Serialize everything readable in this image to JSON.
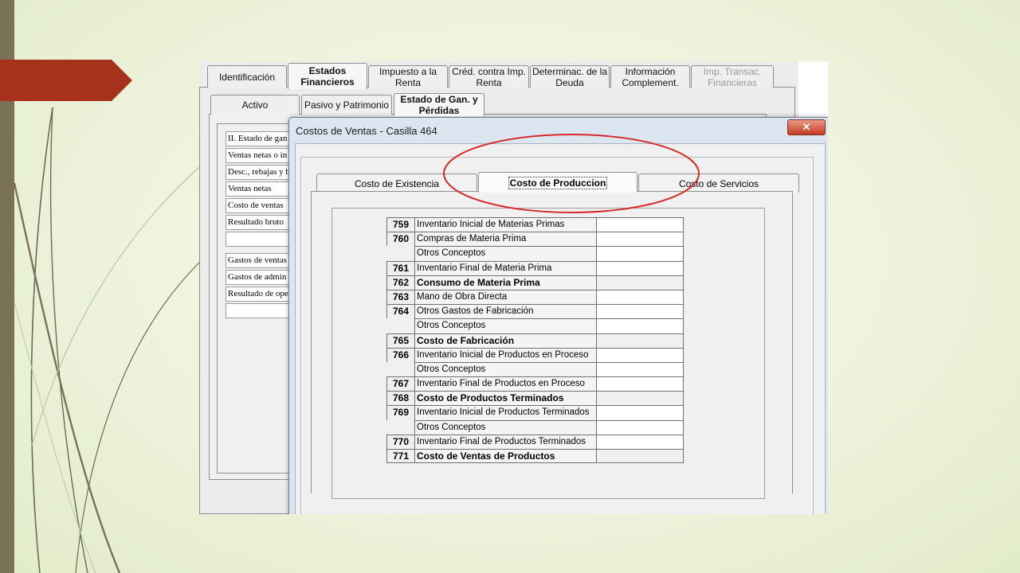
{
  "main_tabs": [
    {
      "label": [
        "Identificación"
      ],
      "state": "normal"
    },
    {
      "label": [
        "Estados",
        "Financieros"
      ],
      "state": "active"
    },
    {
      "label": [
        "Impuesto a la",
        "Renta"
      ],
      "state": "normal"
    },
    {
      "label": [
        "Créd. contra Imp.",
        "Renta"
      ],
      "state": "normal"
    },
    {
      "label": [
        "Determinac. de la",
        "Deuda"
      ],
      "state": "normal"
    },
    {
      "label": [
        "Información",
        "Complement."
      ],
      "state": "normal"
    },
    {
      "label": [
        "Imp. Transac.",
        "Financieras"
      ],
      "state": "disabled"
    }
  ],
  "sub_tabs": [
    {
      "label": [
        "Activo"
      ],
      "state": "normal"
    },
    {
      "label": [
        "Pasivo y Patrimonio"
      ],
      "state": "normal"
    },
    {
      "label": [
        "Estado de Gan. y",
        "Pérdidas"
      ],
      "state": "active"
    }
  ],
  "background_rows": [
    "II. Estado de gan",
    "Ventas netas o in",
    "Desc., rebajas y b",
    "Ventas netas",
    "Costo de ventas",
    "Resultado bruto",
    "",
    "Gastos de ventas",
    "Gastos de admin",
    "Resultado de ope",
    ""
  ],
  "dialog": {
    "title": "Costos de Ventas - Casilla 464",
    "close_label": "✕",
    "tabs": [
      {
        "label": "Costo de Existencia",
        "state": "normal"
      },
      {
        "label": "Costo de Produccion",
        "state": "active"
      },
      {
        "label": "Costo de Servicios",
        "state": "normal"
      }
    ],
    "rows": [
      {
        "code": "759",
        "label": "Inventario Inicial de Materias Primas",
        "bold": false,
        "editable": true,
        "value": ""
      },
      {
        "code": "760",
        "label": "Compras de Materia Prima",
        "bold": false,
        "editable": true,
        "value": ""
      },
      {
        "code": "",
        "label": "Otros Conceptos",
        "bold": false,
        "editable": true,
        "value": ""
      },
      {
        "code": "761",
        "label": "Inventario Final de Materia Prima",
        "bold": false,
        "editable": true,
        "value": ""
      },
      {
        "code": "762",
        "label": "Consumo de Materia Prima",
        "bold": true,
        "editable": false,
        "value": ""
      },
      {
        "code": "763",
        "label": "Mano de Obra Directa",
        "bold": false,
        "editable": true,
        "value": ""
      },
      {
        "code": "764",
        "label": "Otros Gastos de Fabricación",
        "bold": false,
        "editable": true,
        "value": ""
      },
      {
        "code": "",
        "label": "Otros Conceptos",
        "bold": false,
        "editable": true,
        "value": ""
      },
      {
        "code": "765",
        "label": "Costo  de Fabricación",
        "bold": true,
        "editable": false,
        "value": ""
      },
      {
        "code": "766",
        "label": "Inventario Inicial de Productos en Proceso",
        "bold": false,
        "editable": true,
        "value": ""
      },
      {
        "code": "",
        "label": "Otros Conceptos",
        "bold": false,
        "editable": true,
        "value": ""
      },
      {
        "code": "767",
        "label": "Inventario Final de Productos en Proceso",
        "bold": false,
        "editable": true,
        "value": ""
      },
      {
        "code": "768",
        "label": "Costo de Productos Terminados",
        "bold": true,
        "editable": false,
        "value": ""
      },
      {
        "code": "769",
        "label": "Inventario Inicial de Productos Terminados",
        "bold": false,
        "editable": true,
        "value": ""
      },
      {
        "code": "",
        "label": "Otros Conceptos",
        "bold": false,
        "editable": true,
        "value": ""
      },
      {
        "code": "770",
        "label": "Inventario Final de Productos Terminados",
        "bold": false,
        "editable": true,
        "value": ""
      },
      {
        "code": "771",
        "label": "Costo de Ventas de Productos",
        "bold": true,
        "editable": false,
        "value": ""
      }
    ]
  },
  "colors": {
    "slide_bar": "#7b7157",
    "arrow": "#a6321b",
    "highlight_ellipse": "#d42a2a"
  }
}
